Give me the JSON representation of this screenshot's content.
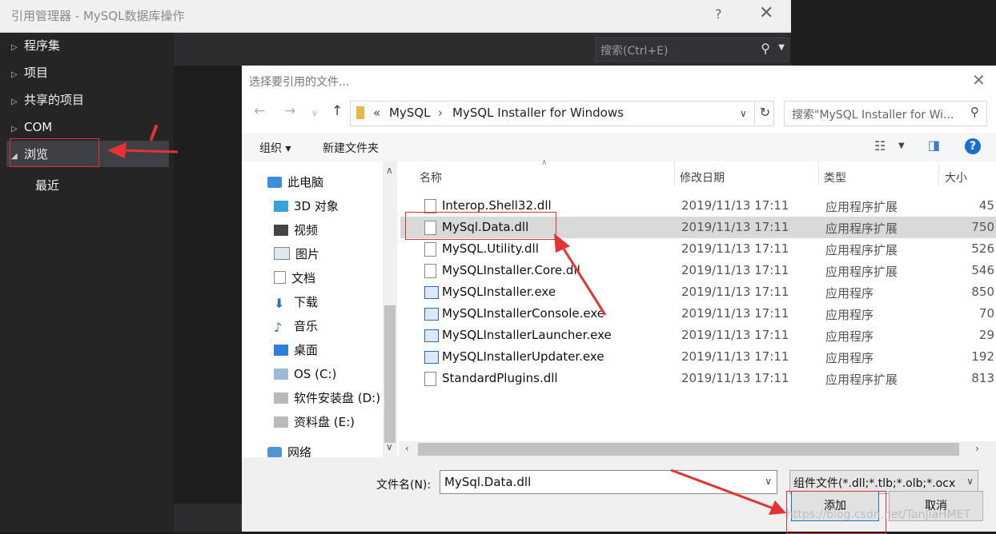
{
  "ref_manager": {
    "title": "引用管理器 - MySQL数据库操作",
    "help": "?",
    "close": "✕",
    "search_placeholder": "搜索(Ctrl+E)",
    "nav": [
      {
        "label": "程序集"
      },
      {
        "label": "项目"
      },
      {
        "label": "共享的项目"
      },
      {
        "label": "COM"
      },
      {
        "label": "浏览"
      },
      {
        "label": "最近"
      }
    ]
  },
  "file_dialog": {
    "title": "选择要引用的文件...",
    "close": "✕",
    "breadcrumb_prefix": "«",
    "breadcrumb": [
      "MySQL",
      "MySQL Installer for Windows"
    ],
    "search_placeholder": "搜索\"MySQL Installer for Wi...",
    "toolbar": {
      "organize": "组织 ▾",
      "new_folder": "新建文件夹",
      "help": "?"
    },
    "tree": [
      {
        "label": "此电脑",
        "icon": "computer-icon"
      },
      {
        "label": "3D 对象",
        "icon": "cube-icon"
      },
      {
        "label": "视频",
        "icon": "video-icon"
      },
      {
        "label": "图片",
        "icon": "picture-icon"
      },
      {
        "label": "文档",
        "icon": "document-icon"
      },
      {
        "label": "下载",
        "icon": "download-icon"
      },
      {
        "label": "音乐",
        "icon": "music-icon"
      },
      {
        "label": "桌面",
        "icon": "desktop-icon"
      },
      {
        "label": "OS (C:)",
        "icon": "windows-drive-icon"
      },
      {
        "label": "软件安装盘 (D:)",
        "icon": "drive-icon"
      },
      {
        "label": "资料盘 (E:)",
        "icon": "drive-icon"
      },
      {
        "label": "网络",
        "icon": "network-icon"
      }
    ],
    "columns": {
      "name": "名称",
      "date": "修改日期",
      "type": "类型",
      "size": "大小"
    },
    "files": [
      {
        "name": "Interop.Shell32.dll",
        "date": "2019/11/13 17:11",
        "type": "应用程序扩展",
        "size": "45",
        "kind": "dll"
      },
      {
        "name": "MySql.Data.dll",
        "date": "2019/11/13 17:11",
        "type": "应用程序扩展",
        "size": "750",
        "kind": "dll"
      },
      {
        "name": "MySQL.Utility.dll",
        "date": "2019/11/13 17:11",
        "type": "应用程序扩展",
        "size": "526",
        "kind": "dll"
      },
      {
        "name": "MySQLInstaller.Core.dll",
        "date": "2019/11/13 17:11",
        "type": "应用程序扩展",
        "size": "546",
        "kind": "dll"
      },
      {
        "name": "MySQLInstaller.exe",
        "date": "2019/11/13 17:11",
        "type": "应用程序",
        "size": "850",
        "kind": "exe"
      },
      {
        "name": "MySQLInstallerConsole.exe",
        "date": "2019/11/13 17:11",
        "type": "应用程序",
        "size": "70",
        "kind": "exe"
      },
      {
        "name": "MySQLInstallerLauncher.exe",
        "date": "2019/11/13 17:11",
        "type": "应用程序",
        "size": "29",
        "kind": "exe"
      },
      {
        "name": "MySQLInstallerUpdater.exe",
        "date": "2019/11/13 17:11",
        "type": "应用程序",
        "size": "192",
        "kind": "exe"
      },
      {
        "name": "StandardPlugins.dll",
        "date": "2019/11/13 17:11",
        "type": "应用程序扩展",
        "size": "813",
        "kind": "dll"
      }
    ],
    "filename_label": "文件名(N):",
    "filename_value": "MySql.Data.dll",
    "filetype_value": "组件文件(*.dll;*.tlb;*.olb;*.ocx",
    "add_button": "添加",
    "cancel_button": "取消"
  },
  "watermark": "https://blog.csdn.net/TanJiaHMET",
  "colors": {
    "annotation": "#e53333",
    "accent": "#0078d7"
  }
}
